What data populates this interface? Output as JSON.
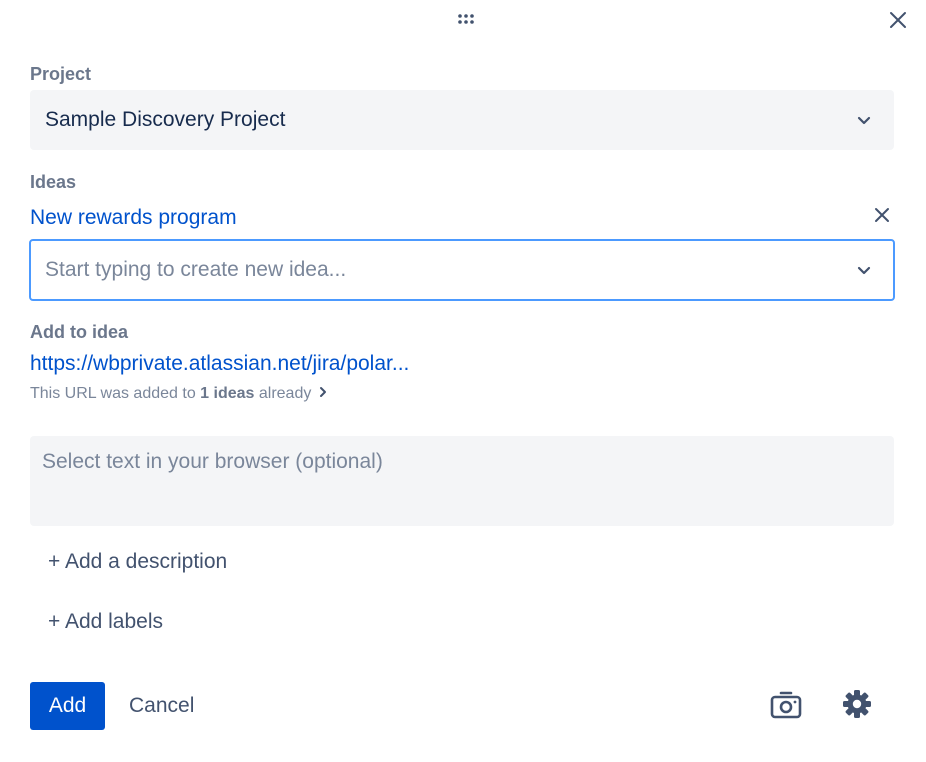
{
  "project": {
    "label": "Project",
    "value": "Sample Discovery Project"
  },
  "ideas": {
    "label": "Ideas",
    "selected": "New rewards program",
    "placeholder": "Start typing to create new idea..."
  },
  "add_to_idea": {
    "label": "Add to idea",
    "url": "https://wbprivate.atlassian.net/jira/polar...",
    "note_prefix": "This URL was added to ",
    "note_bold": "1 ideas",
    "note_suffix": " already"
  },
  "selection": {
    "placeholder": "Select text in your browser (optional)"
  },
  "links": {
    "add_description": "+ Add a description",
    "add_labels": "+ Add labels"
  },
  "footer": {
    "add_label": "Add",
    "cancel_label": "Cancel"
  },
  "icons": {
    "drag": "drag-handle-icon",
    "close": "close-icon",
    "chevron": "chevron-down-icon",
    "remove": "close-icon",
    "chevron_right": "chevron-right-icon",
    "camera": "camera-icon",
    "settings": "gear-icon"
  },
  "colors": {
    "primary": "#0052CC",
    "link": "#0052CC",
    "field_bg": "#F4F5F7",
    "focus_border": "#4C9AFF",
    "label": "#6B778C"
  }
}
